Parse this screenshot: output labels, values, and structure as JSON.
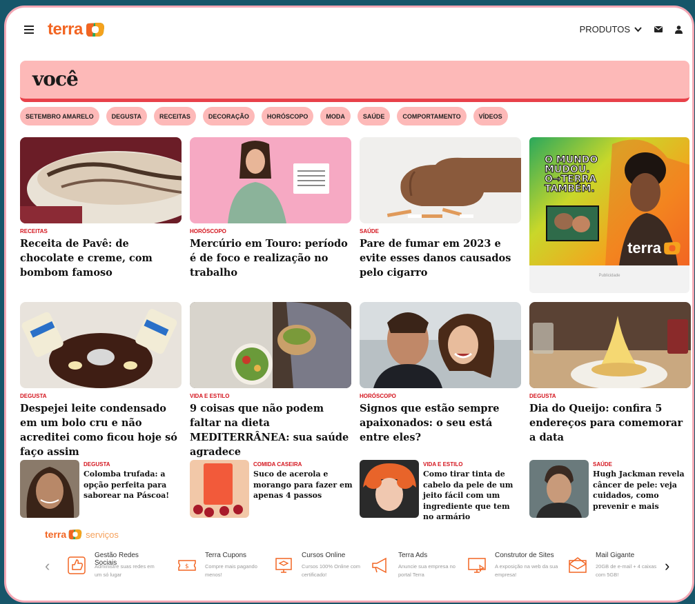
{
  "header": {
    "logo_text": "terra",
    "produtos_label": "PRODUTOS",
    "accent": "#f26522"
  },
  "section": {
    "title": "você"
  },
  "categories": [
    "SETEMBRO AMARELO",
    "DEGUSTA",
    "RECEITAS",
    "DECORAÇÃO",
    "HORÓSCOPO",
    "MODA",
    "SAÚDE",
    "COMPORTAMENTO",
    "VÍDEOS"
  ],
  "cards": [
    {
      "tag": "RECEITAS",
      "title": "Receita de Pavê: de chocolate e creme, com bombom famoso"
    },
    {
      "tag": "HORÓSCOPO",
      "title": "Mercúrio em Touro: período é de foco e realização no trabalho"
    },
    {
      "tag": "SAÚDE",
      "title": "Pare de fumar em 2023 e evite esses danos causados pelo cigarro"
    },
    {
      "tag": "DEGUSTA",
      "title": "Despejei leite condensado em um bolo cru e não acreditei como ficou hoje só faço assim"
    },
    {
      "tag": "VIDA E ESTILO",
      "title": "9 coisas que não podem faltar na dieta MEDITERRÂNEA: sua saúde agradece"
    },
    {
      "tag": "HORÓSCOPO",
      "title": "Signos que estão sempre apaixonados: o seu está entre eles?"
    },
    {
      "tag": "DEGUSTA",
      "title": "Dia do Queijo: confira 5 endereços para comemorar a data"
    }
  ],
  "ad": {
    "headline": [
      "O MUNDO",
      "MUDOU.",
      "O→TERRA",
      "TAMBÉM."
    ],
    "brand": "terra",
    "label": "Publicidade"
  },
  "small_cards": [
    {
      "tag": "DEGUSTA",
      "title": "Colomba trufada: a opção perfeita para saborear na Páscoa!"
    },
    {
      "tag": "COMIDA CASEIRA",
      "title": "Suco de acerola e morango para fazer em apenas 4 passos"
    },
    {
      "tag": "VIDA E ESTILO",
      "title": "Como tirar tinta de cabelo da pele de um jeito fácil com um ingrediente que tem no armário"
    },
    {
      "tag": "SAÚDE",
      "title": "Hugh Jackman revela câncer de pele: veja cuidados, como prevenir e mais"
    }
  ],
  "services": {
    "brand": "terra",
    "title": "serviços",
    "items": [
      {
        "name": "Gestão Redes Sociais",
        "desc": "Administre suas redes em um só lugar",
        "icon": "thumbs-up-icon"
      },
      {
        "name": "Terra Cupons",
        "desc": "Compre mais pagando menos!",
        "icon": "ticket-icon"
      },
      {
        "name": "Cursos Online",
        "desc": "Cursos 100% Online com certificado!",
        "icon": "graduation-icon"
      },
      {
        "name": "Terra Ads",
        "desc": "Anuncie sua empresa no portal Terra",
        "icon": "megaphone-icon"
      },
      {
        "name": "Construtor de Sites",
        "desc": "A exposição na web da sua empresa!",
        "icon": "monitor-icon"
      },
      {
        "name": "Mail Gigante",
        "desc": "20GB de e-mail + 4 caixas com 5GB!",
        "icon": "mail-icon"
      }
    ]
  }
}
